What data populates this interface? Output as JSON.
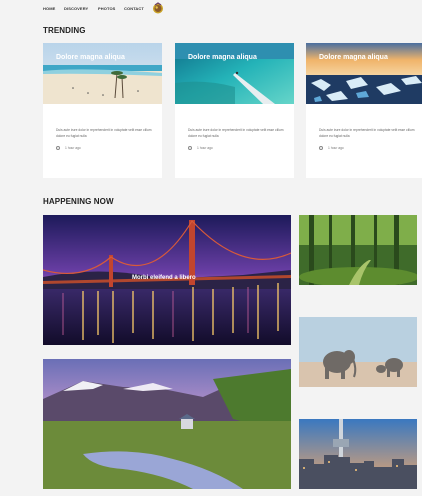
{
  "nav": {
    "items": [
      "HOME",
      "DISCOVERY",
      "PHOTOS",
      "CONTACT"
    ]
  },
  "trending": {
    "title": "TRENDING",
    "cards": [
      {
        "title": "Dolore magna aliqua",
        "text": "Duis aute irure dolor in reprehenderit in voluptate velit esse cillum dolore eu fugiat nulla",
        "meta": "1 hour ago"
      },
      {
        "title": "Dolore magna aliqua",
        "text": "Duis aute irure dolor in reprehenderit in voluptate velit esse cillum dolore eu fugiat nulla",
        "meta": "1 hour ago"
      },
      {
        "title": "Dolore magna aliqua",
        "text": "Duis aute irure dolor in reprehenderit in voluptate velit esse cillum dolore eu fugiat nulla",
        "meta": "1 hour ago"
      }
    ]
  },
  "happening": {
    "title": "HAPPENING NOW",
    "featured_caption": "Morbi eleifend a libero"
  },
  "colors": {
    "background": "#f3f3f3",
    "card": "#ffffff",
    "heading": "#222222"
  },
  "icons": [
    "logo-icon",
    "clock-icon"
  ]
}
